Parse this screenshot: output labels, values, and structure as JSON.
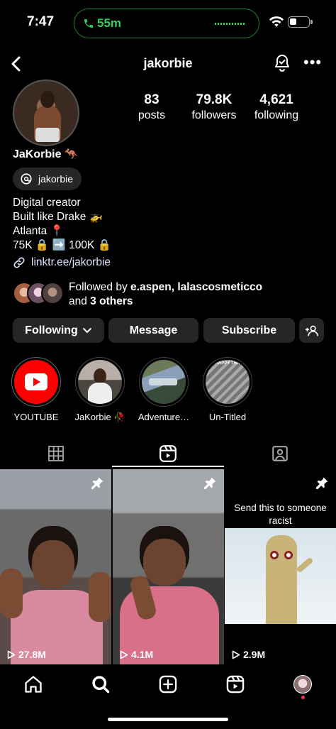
{
  "status_bar": {
    "time": "7:47",
    "call_duration": "55m"
  },
  "header": {
    "username": "jakorbie"
  },
  "stats": [
    {
      "value": "83",
      "label": "posts"
    },
    {
      "value": "79.8K",
      "label": "followers"
    },
    {
      "value": "4,621",
      "label": "following"
    }
  ],
  "profile": {
    "full_name": "JaKorbie 🦘",
    "threads_handle": "jakorbie",
    "bio_lines": [
      "Digital creator",
      "Built like Drake 🚁",
      "Atlanta 📍",
      "75K 🔒 ➡️ 100K 🔒"
    ],
    "link": "linktr.ee/jakorbie"
  },
  "followed_by": {
    "prefix": "Followed by ",
    "names": "e.aspen, lalascosmeticco",
    "and": "and ",
    "others": "3 others"
  },
  "actions": {
    "following": "Following",
    "message": "Message",
    "subscribe": "Subscribe"
  },
  "highlights": [
    {
      "label": "YOUTUBE"
    },
    {
      "label": "JaKorbie 🥀"
    },
    {
      "label": "Adventure…"
    },
    {
      "label": "Un-Titled"
    }
  ],
  "highlight_4_overlay": "HAPPY THA",
  "reels": [
    {
      "views": "27.8M",
      "pinned": true
    },
    {
      "views": "4.1M",
      "pinned": true
    },
    {
      "views": "2.9M",
      "pinned": true,
      "caption": "Send this to someone racist"
    }
  ],
  "colors": {
    "background": "#000000",
    "button_bg": "#262626",
    "call_green": "#34d058",
    "youtube_red": "#ff0000"
  }
}
